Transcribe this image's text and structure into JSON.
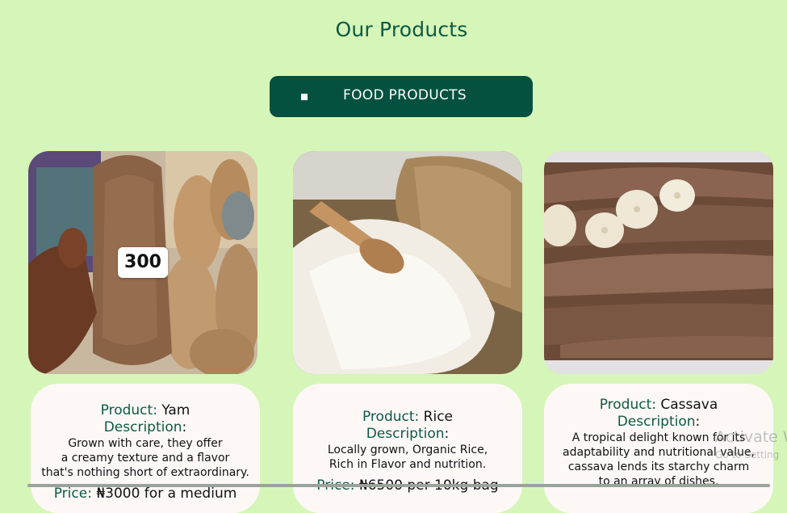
{
  "page": {
    "title": "Our Products"
  },
  "category": {
    "bullet": "■",
    "label": "FOOD PRODUCTS"
  },
  "products": [
    {
      "image_alt": "yam-image",
      "price_tag": "300",
      "product_label": "Product:",
      "product_name": " Yam",
      "description_label": "Description",
      "description_colon": ":",
      "description_lines": [
        "Grown with care, they offer",
        "a creamy texture and a flavor",
        "that's nothing short of extraordinary."
      ],
      "price_label": "Price:",
      "price_value": " ₦3000 for a medium"
    },
    {
      "image_alt": "rice-image",
      "product_label": "Product:",
      "product_name": " Rice",
      "description_label": "Description",
      "description_colon": ":",
      "description_lines": [
        "Locally grown, Organic Rice,",
        "Rich in Flavor and nutrition."
      ],
      "price_label": "Price:",
      "price_value": " ₦6500 per 10kg bag"
    },
    {
      "image_alt": "cassava-image",
      "product_label": "Product:",
      "product_name": " Cassava",
      "description_label": "Description",
      "description_colon": ":",
      "description_lines": [
        "A tropical delight known for its",
        "adaptability and nutritional value,",
        "cassava lends its starchy charm",
        "to an array of dishes."
      ]
    }
  ],
  "watermark": {
    "title": "Activate W",
    "subtitle": "Go to Setting"
  },
  "colors": {
    "background": "#d5f6b8",
    "accent": "#04513f",
    "label_green": "#0c5a44"
  }
}
